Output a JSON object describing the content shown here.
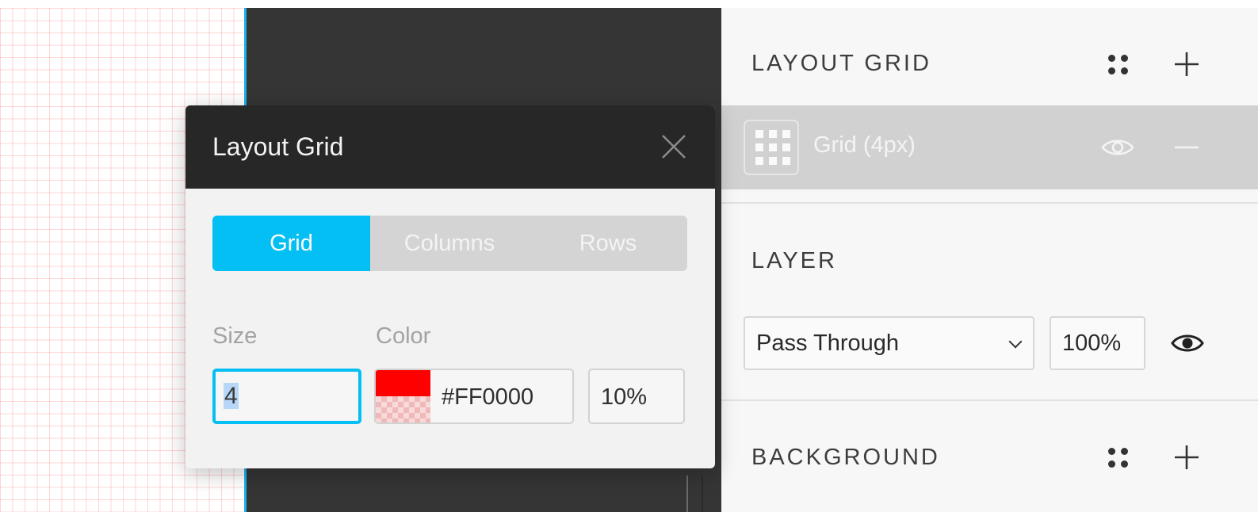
{
  "canvas": {
    "grid_color": "#FF0000"
  },
  "popup": {
    "title": "Layout Grid",
    "tabs": [
      {
        "label": "Grid",
        "active": true
      },
      {
        "label": "Columns",
        "active": false
      },
      {
        "label": "Rows",
        "active": false
      }
    ],
    "size": {
      "label": "Size",
      "value": "4"
    },
    "color": {
      "label": "Color",
      "hex": "#FF0000",
      "opacity": "10%"
    },
    "close_icon": "close-icon"
  },
  "panel": {
    "layout_grid": {
      "title": "LAYOUT GRID",
      "item": {
        "label": "Grid (4px)",
        "icon": "grid-icon"
      }
    },
    "layer": {
      "title": "LAYER",
      "blend_mode": "Pass Through",
      "opacity": "100%"
    },
    "background": {
      "title": "BACKGROUND"
    }
  },
  "colors": {
    "accent": "#04BFF4",
    "dark_header": "#272727",
    "grid_row": "#D1D1D1"
  }
}
